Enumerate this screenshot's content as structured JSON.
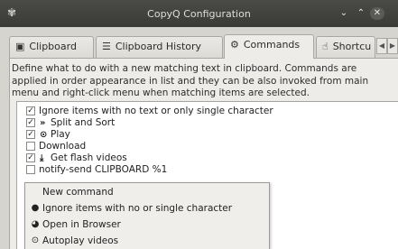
{
  "window": {
    "title": "CopyQ Configuration",
    "app_icon": "copyq-icon",
    "minimize_glyph": "⌄",
    "maximize_glyph": "⌃",
    "close_glyph": "✕"
  },
  "tabs": [
    {
      "label": "Clipboard",
      "icon": "clipboard-icon",
      "glyph": "▣"
    },
    {
      "label": "Clipboard History",
      "icon": "list-icon",
      "glyph": "☰"
    },
    {
      "label": "Commands",
      "icon": "gears-icon",
      "glyph": "⚙"
    },
    {
      "label": "Shortcu",
      "icon": "hand-pointer-icon",
      "glyph": "☝"
    }
  ],
  "tab_scroll": {
    "left": "◀",
    "right": "▶"
  },
  "description": "Define what to do with a new matching text in clipboard. Commands are applied in order appearance in list and they can be also invoked from main menu and right-click menu when matching items are selected.",
  "commands": [
    {
      "label": "Ignore items with no text or only single character",
      "checked": true,
      "check_glyph": "✓",
      "icon": ""
    },
    {
      "label": "Split and Sort",
      "checked": true,
      "check_glyph": "✓",
      "icon": "chevrons-down-icon",
      "icon_glyph": "»"
    },
    {
      "label": "Play",
      "checked": true,
      "check_glyph": "✓",
      "icon": "play-circle-icon",
      "icon_glyph": "⊙"
    },
    {
      "label": "Download",
      "checked": false,
      "check_glyph": "",
      "icon": ""
    },
    {
      "label": "Get flash videos",
      "checked": true,
      "check_glyph": "✓",
      "icon": "download-icon",
      "icon_glyph": "⤓"
    },
    {
      "label": "notify-send CLIPBOARD %1",
      "checked": false,
      "check_glyph": "",
      "icon": ""
    }
  ],
  "context_menu": [
    {
      "label": "New command",
      "icon": "",
      "glyph": ""
    },
    {
      "label": "Ignore items with no or single character",
      "icon": "exclamation-circle-icon",
      "glyph": "●"
    },
    {
      "label": "Open in Browser",
      "icon": "globe-icon",
      "glyph": "◕"
    },
    {
      "label": "Autoplay videos",
      "icon": "play-circle-icon",
      "glyph": "⊙"
    }
  ]
}
